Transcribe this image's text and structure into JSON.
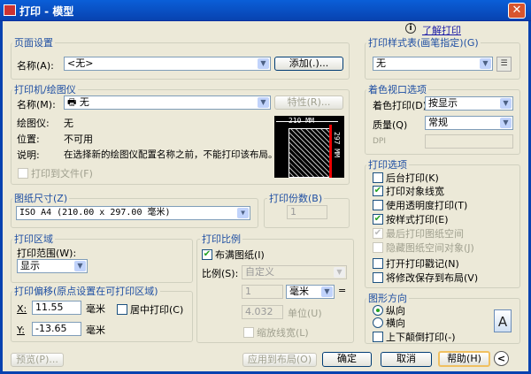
{
  "window": {
    "title": "打印 - 模型",
    "close": "✕"
  },
  "help_link": "了解打印",
  "page_setup": {
    "title": "页面设置",
    "name_label": "名称(A):",
    "name_value": "<无>",
    "add_button": "添加(.)..."
  },
  "printer": {
    "title": "打印机/绘图仪",
    "name_label": "名称(M):",
    "name_value": "无",
    "properties_button": "特性(R)...",
    "plotter_label": "绘图仪:",
    "plotter_value": "无",
    "location_label": "位置:",
    "location_value": "不可用",
    "desc_label": "说明:",
    "desc_value": "在选择新的绘图仪配置名称之前，不能打印该布局。",
    "print_to_file": "打印到文件(F)",
    "preview_width": "210 MM",
    "preview_height": "297 MM"
  },
  "paper_size": {
    "title": "图纸尺寸(Z)",
    "value": "ISO A4 (210.00 x 297.00 毫米)"
  },
  "copies": {
    "title": "打印份数(B)",
    "value": "1"
  },
  "plot_area": {
    "title": "打印区域",
    "range_label": "打印范围(W):",
    "range_value": "显示"
  },
  "plot_offset": {
    "title": "打印偏移(原点设置在可打印区域)",
    "x_label": "X:",
    "x_value": "11.55",
    "y_label": "Y:",
    "y_value": "-13.65",
    "unit": "毫米",
    "center": "居中打印(C)"
  },
  "plot_scale": {
    "title": "打印比例",
    "fit": "布满图纸(I)",
    "scale_label": "比例(S):",
    "scale_value": "自定义",
    "num_value": "1",
    "unit_value": "毫米",
    "equals": "=",
    "den_value": "4.032",
    "den_unit": "单位(U)",
    "scale_lw": "缩放线宽(L)"
  },
  "style_table": {
    "title": "打印样式表(画笔指定)(G)",
    "value": "无"
  },
  "shaded": {
    "title": "着色视口选项",
    "shade_label": "着色打印(D)",
    "shade_value": "按显示",
    "quality_label": "质量(Q)",
    "quality_value": "常规",
    "dpi_label": "DPI"
  },
  "options": {
    "title": "打印选项",
    "items": [
      {
        "label": "后台打印(K)",
        "checked": false,
        "disabled": false
      },
      {
        "label": "打印对象线宽",
        "checked": true,
        "disabled": false
      },
      {
        "label": "使用透明度打印(T)",
        "checked": false,
        "disabled": false
      },
      {
        "label": "按样式打印(E)",
        "checked": true,
        "disabled": false
      },
      {
        "label": "最后打印图纸空间",
        "checked": true,
        "disabled": true
      },
      {
        "label": "隐藏图纸空间对象(J)",
        "checked": false,
        "disabled": true
      },
      {
        "label": "打开打印戳记(N)",
        "checked": false,
        "disabled": false
      },
      {
        "label": "将修改保存到布局(V)",
        "checked": false,
        "disabled": false
      }
    ]
  },
  "orientation": {
    "title": "图形方向",
    "portrait": "纵向",
    "landscape": "横向",
    "upside": "上下颠倒打印(-)",
    "icon_letter": "A"
  },
  "buttons": {
    "preview": "预览(P)...",
    "apply": "应用到布局(O)",
    "ok": "确定",
    "cancel": "取消",
    "help": "帮助(H)",
    "collapse": "<"
  }
}
